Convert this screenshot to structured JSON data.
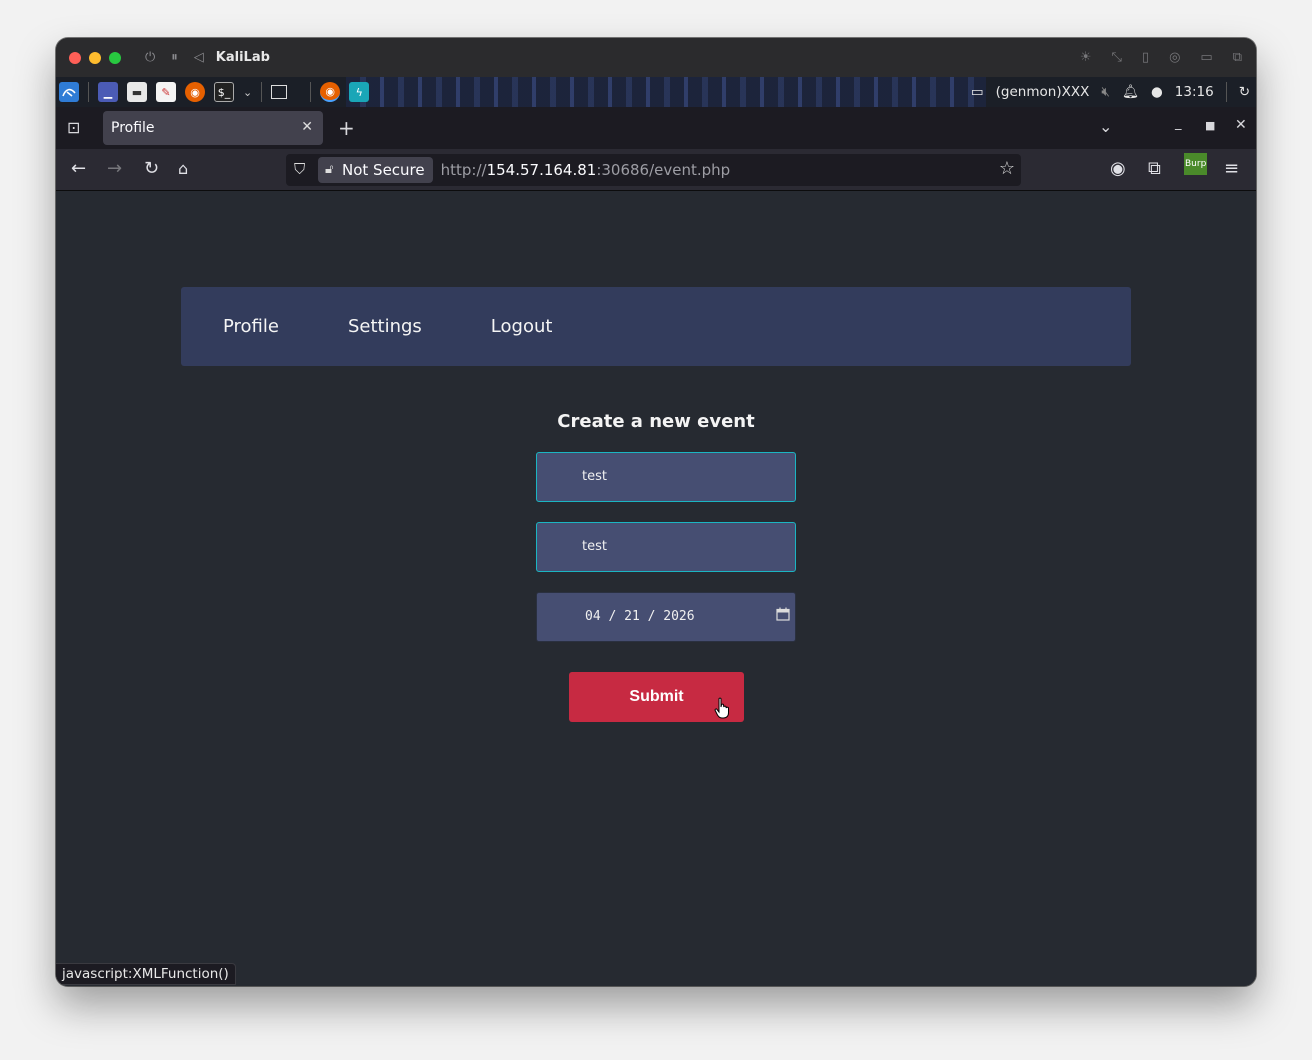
{
  "titlebar": {
    "title": "KaliLab"
  },
  "panel": {
    "genmon_text": "(genmon)XXX",
    "clock": "13:16",
    "burp_badge": "Burp"
  },
  "browser": {
    "tab_title": "Profile",
    "not_secure_label": "Not Secure",
    "url_scheme": "http://",
    "url_host": "154.57.164.81",
    "url_rest": ":30686/event.php",
    "status_text": "javascript:XMLFunction()"
  },
  "site": {
    "nav_items": [
      "Profile",
      "Settings",
      "Logout"
    ],
    "form_title": "Create a new event",
    "field1_value": "test",
    "field2_value": "test",
    "date_value": "04 / 21 / 2026",
    "submit_label": "Submit"
  },
  "colors": {
    "page_bg": "#262a31",
    "nav_bg": "#333c5c",
    "field_bg": "#464e72",
    "field_border_focus": "#1bb5c2",
    "submit_bg": "#c72a42"
  }
}
